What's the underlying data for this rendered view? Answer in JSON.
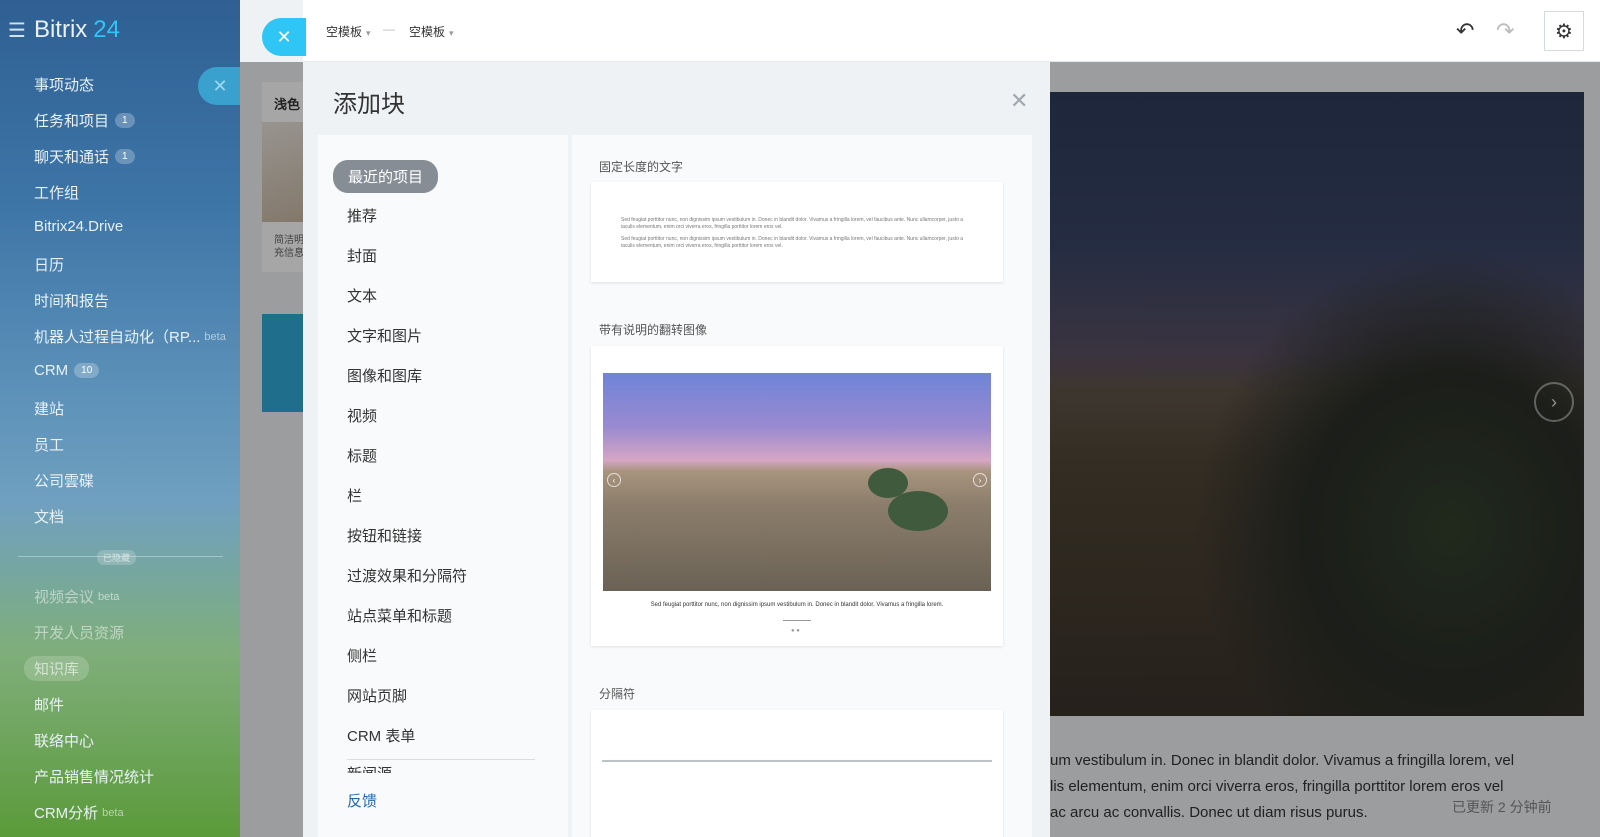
{
  "sidebar": {
    "brand": "Bitrix",
    "brand_number": "24",
    "items": [
      {
        "label": "事项动态"
      },
      {
        "label": "任务和项目",
        "badge": "1"
      },
      {
        "label": "聊天和通话",
        "badge": "1"
      },
      {
        "label": "工作组"
      },
      {
        "label": "Bitrix24.Drive"
      },
      {
        "label": "日历"
      },
      {
        "label": "时间和报告"
      },
      {
        "label": "机器人过程自动化（RP...",
        "sup": "beta"
      },
      {
        "label": "CRM",
        "badge": "10"
      },
      {
        "label": "建站"
      },
      {
        "label": "员工"
      },
      {
        "label": "公司雲碟"
      },
      {
        "label": "文档"
      }
    ],
    "hidden_label": "已隐藏",
    "hidden_items": [
      {
        "label": "视频会议",
        "sup": "beta"
      },
      {
        "label": "开发人员资源"
      },
      {
        "label": "知识库"
      },
      {
        "label": "邮件"
      },
      {
        "label": "联络中心"
      },
      {
        "label": "产品销售情况统计"
      },
      {
        "label": "CRM分析",
        "sup": "beta"
      }
    ]
  },
  "toolbar": {
    "breadcrumb1": "空模板",
    "breadcrumb_sep": "—",
    "breadcrumb2": "空模板"
  },
  "background": {
    "card_title": "浅色",
    "card_text": "简洁明\n充信息",
    "body_text_lines": [
      "um vestibulum in. Donec in blandit dolor. Vivamus a fringilla lorem, vel",
      "lis elementum, enim orci viverra eros, fringilla porttitor lorem eros vel",
      "ac arcu ac convallis. Donec ut diam risus purus."
    ],
    "updated": "已更新 2 分钟前"
  },
  "dialog": {
    "title": "添加块",
    "categories": [
      "最近的项目",
      "推荐",
      "封面",
      "文本",
      "文字和图片",
      "图像和图库",
      "视频",
      "标题",
      "栏",
      "按钮和链接",
      "过渡效果和分隔符",
      "站点菜单和标题",
      "侧栏",
      "网站页脚",
      "CRM 表单",
      "新闻源"
    ],
    "feedback": "反馈",
    "blocks": [
      {
        "title": "固定长度的文字",
        "preview_text": "Sed feugiat porttitor nunc, non dignissim ipsum vestibulum in. Donec in blandit dolor. Vivamus a fringilla lorem, vel faucibus ante. Nunc ullamcorper, justo a iaculis elementum, enim orci viverra eros, fringilla porttitor lorem eros vel."
      },
      {
        "title": "带有说明的翻转图像",
        "caption": "Sed feugiat porttitor nunc, non dignissim ipsum vestibulum in. Donec in blandit dolor. Vivamus a fringilla lorem."
      },
      {
        "title": "分隔符"
      }
    ]
  },
  "colors": {
    "accent": "#2fc6f6",
    "active_category": "#868d95",
    "link": "#2067b0"
  }
}
